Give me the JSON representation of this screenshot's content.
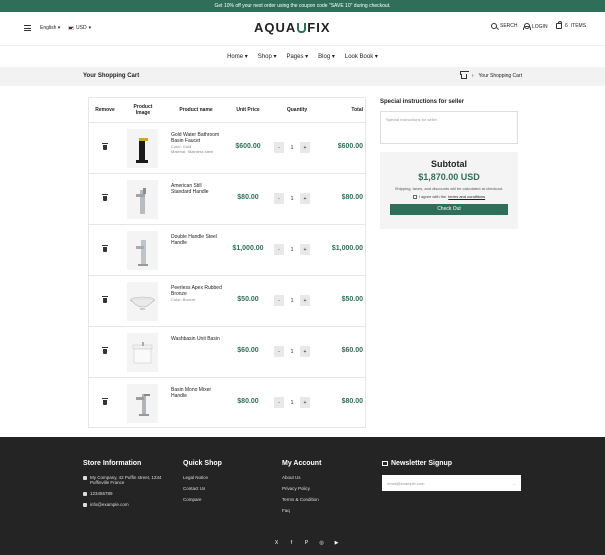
{
  "announcement": "Get 10% off your next order using the coupon code \"SAVE 10\" during checkout.",
  "header": {
    "language": "English",
    "currency": "USD",
    "logo_left": "AQUA",
    "logo_right": "FIX",
    "search": "SERCH",
    "login": "LOGIN",
    "cart_count": "6",
    "cart_label": "ITEMS"
  },
  "nav": [
    "Home",
    "Shop",
    "Pages",
    "Blog",
    "Look Book"
  ],
  "breadcrumb": {
    "title": "Your Shopping Cart",
    "current": "Your Shopping Cart"
  },
  "table": {
    "headers": [
      "Remove",
      "Product Image",
      "Product name",
      "Unit Price",
      "Quantity",
      "Total"
    ],
    "rows": [
      {
        "name": "Gold Water Bathroom Basin Faucet",
        "variant1": "Color: Gold",
        "variant2": "Material: Stainless steel",
        "price": "$600.00",
        "qty": "1",
        "total": "$600.00"
      },
      {
        "name": "American Still Standard Handle",
        "variant1": "",
        "variant2": "",
        "price": "$80.00",
        "qty": "1",
        "total": "$80.00"
      },
      {
        "name": "Double Handle Steel Handle",
        "variant1": "",
        "variant2": "",
        "price": "$1,000.00",
        "qty": "1",
        "total": "$1,000.00"
      },
      {
        "name": "Peerless Apex Rubbed Bronze",
        "variant1": "Color: Bronze",
        "variant2": "",
        "price": "$50.00",
        "qty": "1",
        "total": "$50.00"
      },
      {
        "name": "Washbasin Unit Basin",
        "variant1": "",
        "variant2": "",
        "price": "$60.00",
        "qty": "1",
        "total": "$60.00"
      },
      {
        "name": "Basin Mono Mixer Handle",
        "variant1": "",
        "variant2": "",
        "price": "$80.00",
        "qty": "1",
        "total": "$80.00"
      }
    ],
    "minus": "-",
    "plus": "+"
  },
  "side": {
    "instructions_title": "Special instructions for seller",
    "instructions_placeholder": "Special instructions for seller",
    "subtotal_label": "Subtotal",
    "subtotal_value": "$1,870.00 USD",
    "note": "Shipping, taxes, and discounts will be calculated at checkout.",
    "agree_prefix": "I agree with the",
    "agree_link": "terms and conditions",
    "checkout": "Check Out"
  },
  "footer": {
    "store_title": "Store Information",
    "address": "My Company, 42 Puffin street, 1234 Puffinville France",
    "phone": "123456789",
    "email": "info@example.com",
    "quick_title": "Quick Shop",
    "quick_links": [
      "Legal Notice",
      "Contact Us",
      "Compare"
    ],
    "account_title": "My Account",
    "account_links": [
      "About Us",
      "Privacy Policy",
      "Terms & Condition",
      "Faq"
    ],
    "news_title": "Newsletter Signup",
    "news_placeholder": "email@example.com",
    "social": [
      "X",
      "f",
      "P",
      "◎",
      "▶"
    ]
  },
  "colors": {
    "accent": "#2f6f5a",
    "footer_bg": "#242424"
  }
}
